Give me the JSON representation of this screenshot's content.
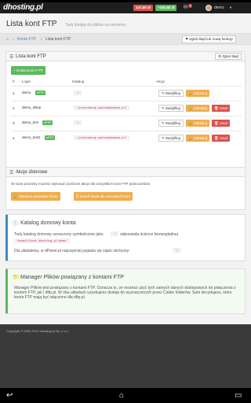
{
  "topbar": {
    "logo": "dhosting.pl",
    "balance_red": "147,60 zł",
    "balance_green": "+194,80 zł",
    "bell_count": "1",
    "username": "demo"
  },
  "page": {
    "title": "Lista kont FTP",
    "subtitle": "Twój dostęp do plików na serwerze"
  },
  "breadcrumb": {
    "items": [
      "Konta FTP",
      "Lista kont FTP"
    ],
    "report_button": "Zgłoś błąd lub nową funkcję"
  },
  "ftp_panel": {
    "title": "Lista kont FTP",
    "report_button": "Zgłoś błąd",
    "add_button": "+ Dodaj konto FTP",
    "headers": [
      "#",
      "Login",
      "Katalog",
      "Akcje"
    ],
    "rows": [
      {
        "num": "1",
        "login": "demo",
        "badge": "sFTP",
        "dir": "~/",
        "actions": [
          "Modyfikuj",
          "Zablokuj"
        ]
      },
      {
        "num": "2",
        "login": "demo_sklep",
        "badge": "",
        "dir": "~/prestashop.wybranadomena.pl/",
        "actions": [
          "Modyfikuj",
          "Zablokuj",
          "Usuń"
        ]
      },
      {
        "num": "3",
        "login": "demo_test",
        "badge": "sFTP",
        "dir": "~/",
        "actions": [
          "Modyfikuj",
          "Zablokuj",
          "Usuń"
        ]
      },
      {
        "num": "4",
        "login": "demo_test2",
        "badge": "sFTP",
        "dir": "~/prestashop.wybranadomena.pl/",
        "actions": [
          "Modyfikuj",
          "Zablokuj",
          "Usuń"
        ]
      }
    ]
  },
  "bulk_panel": {
    "title": "Akcje zbiorowe",
    "text": "W razie potrzeby możesz wykonać poniższe akcje dla wszystkich kont FTP jednocześnie.",
    "lock_all": "Zablokuj wszystkie konta",
    "change_pass_all": "Zmień hasła dla wszystkich kont"
  },
  "catalog_info": {
    "title": "Katalog domowy konta",
    "line1_a": "Twój katalog domowy oznaczony symbolicznie jako",
    "line1_code": "~/",
    "line1_b": "odpowiada ścieżce bezwzględnej",
    "line2_code": "/home/klient.dhosting.pl/demo/",
    "line3_a": "Dla ułatwienia, w dPanel.pl najczęściej pojawia się zapis skrócony:",
    "line3_code": "~/"
  },
  "manager_info": {
    "title": "Manager Plików powiązany z kontami FTP",
    "text": "Manager Plików jest powiązany z kontami FTP. Oznacza to, że możesz użyć tych samych danych dostępowych do połączenia z kontem FTP, jak i dftp.pl. W obu układach uzyskujesz dostęp do wyznaczonych przez Ciebie folderów. Sam decydujesz, które konta FTP mają być włączone dla dftp.pl."
  },
  "footer": {
    "copyright": "Copyright © 2002-2014 dhosting.pl Sp. z o.o."
  }
}
